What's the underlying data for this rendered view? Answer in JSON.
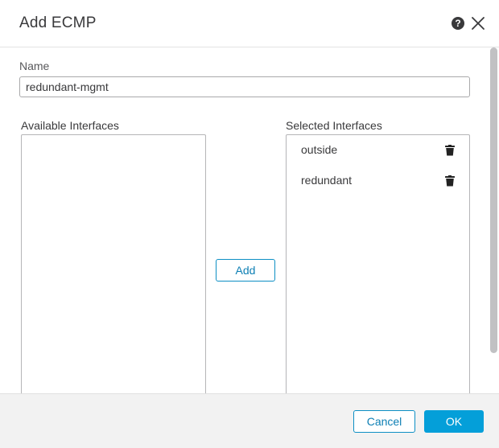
{
  "dialog": {
    "title": "Add ECMP",
    "help_icon": "question-circle-icon",
    "close_icon": "close-x-icon"
  },
  "form": {
    "name_label": "Name",
    "name_value": "redundant-mgmt",
    "available_label": "Available Interfaces",
    "selected_label": "Selected Interfaces",
    "available_items": [],
    "selected_items": [
      {
        "label": "outside",
        "icon": "trash-icon"
      },
      {
        "label": "redundant",
        "icon": "trash-icon"
      }
    ],
    "add_label": "Add"
  },
  "footer": {
    "cancel_label": "Cancel",
    "ok_label": "OK"
  },
  "colors": {
    "primary": "#049fd9",
    "primary_outline": "#0d8fc4",
    "text": "#39393b",
    "footer_bg": "#f2f2f2"
  }
}
